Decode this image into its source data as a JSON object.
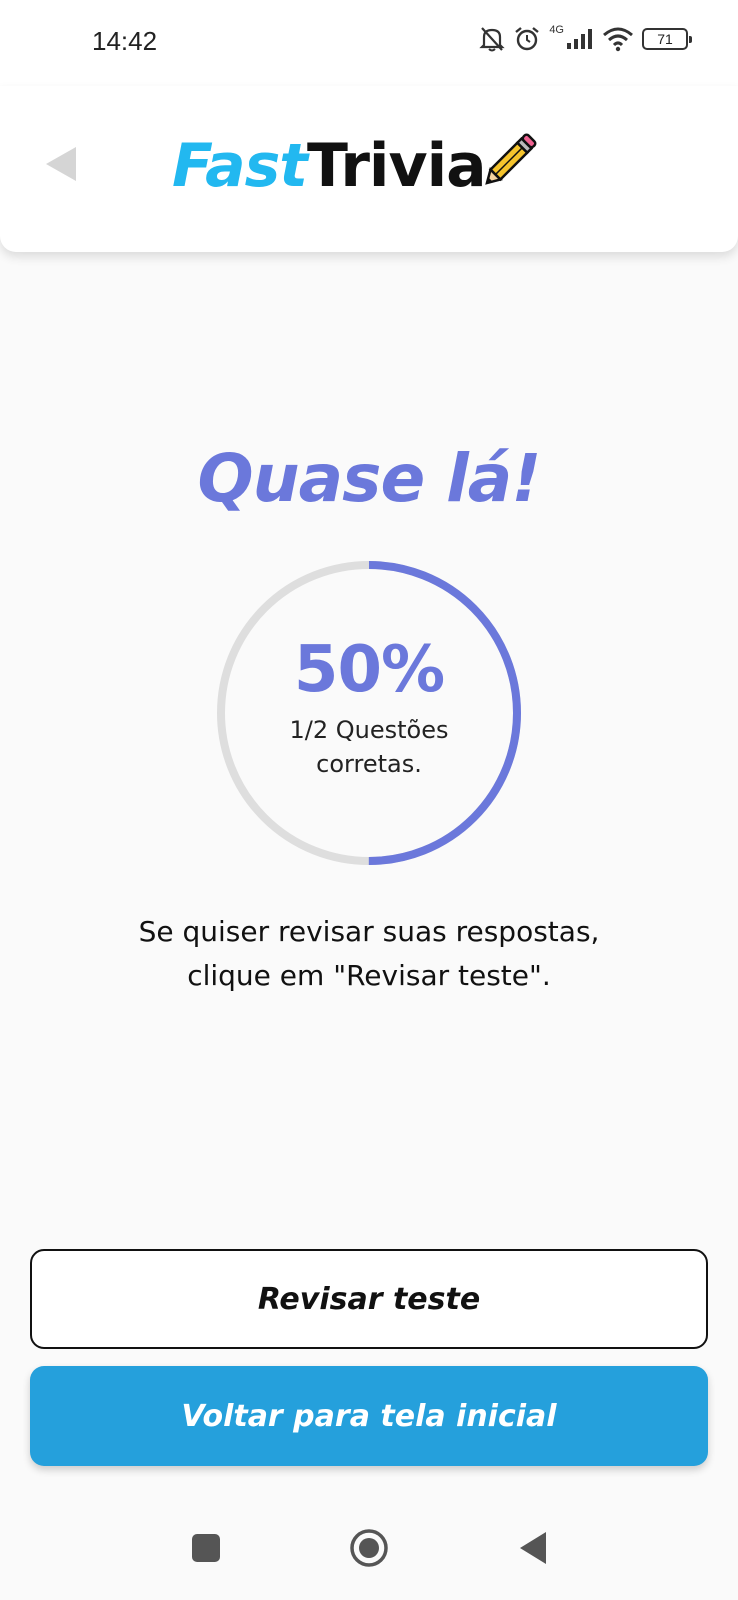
{
  "status_bar": {
    "time": "14:42",
    "network_label": "4G",
    "battery_level": "71",
    "icons": [
      "bell-off-icon",
      "alarm-icon",
      "signal-icon",
      "wifi-icon",
      "battery-icon"
    ]
  },
  "header": {
    "back_icon": "back-arrow-icon",
    "logo_part1": "Fast",
    "logo_part2": "Trivia",
    "logo_icon": "pencil-icon"
  },
  "result": {
    "title": "Quase lá!",
    "percent_label": "50%",
    "progress_fraction": 0.5,
    "detail": "1/2 Questões corretas.",
    "hint": "Se quiser revisar suas respostas, clique em \"Revisar teste\"."
  },
  "buttons": {
    "review": "Revisar teste",
    "home": "Voltar para tela inicial"
  },
  "nav": {
    "icons": [
      "recents-icon",
      "home-icon",
      "back-icon"
    ]
  },
  "colors": {
    "accent": "#6b78db",
    "primary_button": "#25a0dc",
    "logo_blue": "#22b8f0",
    "ring_track": "#dedede"
  }
}
